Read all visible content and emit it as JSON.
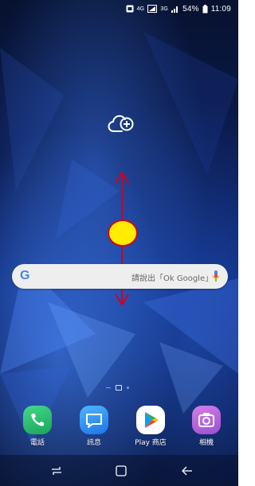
{
  "status_bar": {
    "network_4g_label": "4G",
    "network_3g_label": "3G",
    "battery_percent": "54%",
    "time": "11:09"
  },
  "search_bar": {
    "logo_text": "G",
    "hint": "請說出「Ok Google」"
  },
  "dock": {
    "apps": [
      {
        "label": "電話",
        "icon": "phone-icon"
      },
      {
        "label": "訊息",
        "icon": "message-icon"
      },
      {
        "label": "Play 商店",
        "icon": "play-store-icon"
      },
      {
        "label": "相機",
        "icon": "camera-icon"
      }
    ]
  },
  "navigation": {
    "recent_icon": "recent-apps-icon",
    "home_icon": "home-icon",
    "back_icon": "back-icon"
  },
  "colors": {
    "wallpaper_dark": "#07112f",
    "wallpaper_blue": "#2a5fd6",
    "overlay_arrow": "#d4001b",
    "overlay_dot": "#ffec00",
    "search_bar_bg": "#eeeeee"
  }
}
